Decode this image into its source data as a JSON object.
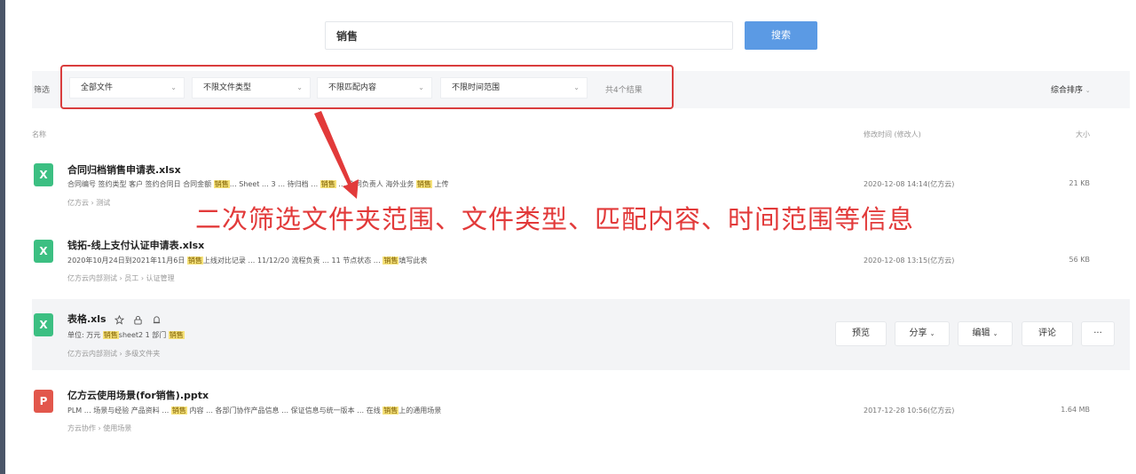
{
  "search": {
    "query": "销售",
    "button": "搜索"
  },
  "filter": {
    "label": "筛选",
    "dropdowns": [
      "全部文件",
      "不限文件类型",
      "不限匹配内容",
      "不限时间范围"
    ],
    "total": "共4个结果",
    "sort": "综合排序"
  },
  "columns": {
    "name": "名称",
    "modified": "修改时间 (修改人)",
    "size": "大小"
  },
  "files": [
    {
      "icon": "X",
      "name": "合同归档销售申请表.xlsx",
      "snippet_a": "合同编号 签约类型 客户 签约合同日 合同金额 ",
      "hl_a": "销售",
      "snippet_b": "… Sheet … 3 … 待归档 … ",
      "hl_b": "销售",
      "snippet_c": " … 合同负责人 海外业务 ",
      "hl_c": "销售",
      "snippet_d": " 上传",
      "crumb": "亿方云 › 测试",
      "modified": "2020-12-08 14:14(亿方云)",
      "size": "21 KB"
    },
    {
      "icon": "X",
      "name": "钱拓-线上支付认证申请表.xlsx",
      "snippet_a": "2020年10月24日到2021年11月6日 ",
      "hl_a": "销售",
      "snippet_b": "上线对比记录 … 11/12/20 流程负责 … 11 节点状态 … ",
      "hl_b": "销售",
      "snippet_c": "填写此表",
      "crumb": "亿方云内部测试 › 员工 › 认证管理",
      "modified": "2020-12-08 13:15(亿方云)",
      "size": "56 KB"
    },
    {
      "icon": "X",
      "name": "表格.xls",
      "snippet_a": "单位: 万元 ",
      "hl_a": "销售",
      "snippet_b": "sheet2 1 部门 ",
      "hl_b": "销售",
      "crumb": "亿方云内部测试 › 多级文件夹",
      "actions": [
        "预览",
        "分享",
        "编辑",
        "评论"
      ],
      "more": "···"
    },
    {
      "icon": "P",
      "name": "亿方云使用场景(for销售).pptx",
      "snippet_a": "PLM … 场景与经验 产品资料 … ",
      "hl_a": "销售",
      "snippet_b": " 内容 … 各部门协作产品信息 … 保证信息与统一版本 … 在线 ",
      "hl_b": "销售",
      "snippet_c": "上的通用场景",
      "crumb": "方云协作 › 使用场景",
      "modified": "2017-12-28 10:56(亿方云)",
      "size": "1.64 MB"
    }
  ],
  "annotation": "二次筛选文件夹范围、文件类型、匹配内容、时间范围等信息",
  "colors": {
    "accent": "#4a90e2",
    "annotation": "#e23a3a",
    "xlsx": "#3cbf82",
    "pptx": "#e2574c"
  }
}
